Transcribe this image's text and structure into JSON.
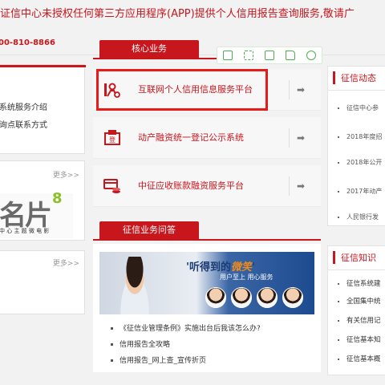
{
  "notice": "证信中心未授权任何第三方应用程序(APP)提供个人信用报告查询服务,敬请广",
  "phone": "00-810-8866",
  "left": {
    "panel1_items": [
      "系统服务介绍",
      "询点联系方式"
    ],
    "panel2_more": "更多>>",
    "mingpian": {
      "big_text": "名片",
      "number": "8",
      "tag": "中 心 主 题 微 电 影"
    },
    "panel3_more": "更多>>"
  },
  "core": {
    "tab": "核心业务",
    "toolbar_icons": [
      "phone-icon",
      "expand-icon",
      "save-icon",
      "share-icon",
      "settings-icon"
    ],
    "services": [
      {
        "name": "互联网个人信用信息服务平台",
        "icon": "person-search-icon",
        "arrow": "➡"
      },
      {
        "name": "动产融资统一登记公示系统",
        "icon": "register-icon",
        "arrow": "➡"
      },
      {
        "name": "中征应收账款融资服务平台",
        "icon": "card-coins-icon",
        "arrow": "➡"
      }
    ]
  },
  "qa": {
    "tab": "征信业务问答",
    "slogan_prefix": "'听得到的",
    "slogan_highlight": "微笑",
    "slogan_suffix": "'",
    "slogan_sub": "用户至上  用心服务",
    "items": [
      "《征信业管理条例》实施出台后我该怎么办?",
      "信用报告全攻略",
      "信用报告_网上查_宣传折页"
    ]
  },
  "right": {
    "news_title": "征信动态",
    "news_items": [
      "征信中心参",
      "2018年度招",
      "2018年公开",
      "2017年动产",
      "人民银行发"
    ],
    "knowledge_title": "征信知识",
    "knowledge_items": [
      "征信系统建",
      "全国集中统",
      "有关信用记",
      "征信基本知",
      "征信基本概"
    ]
  },
  "colors": {
    "brand_red": "#c8161d",
    "highlight_red": "#e81b1b",
    "toolbar_green": "#4caf50"
  }
}
